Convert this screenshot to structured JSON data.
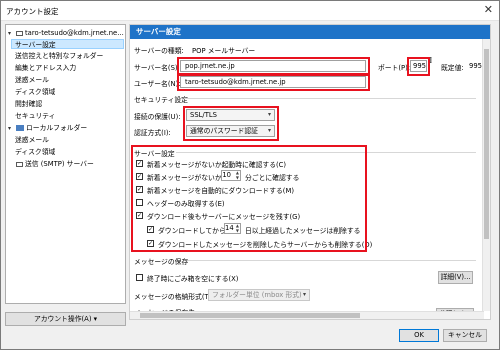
{
  "window": {
    "title": "アカウント設定",
    "close_glyph": "✕"
  },
  "tree": {
    "account": "taro-tetsudo@kdm.jrnet.ne...",
    "account_children": [
      "サーバー設定",
      "送信控えと特別なフォルダー",
      "編集とアドレス入力",
      "迷惑メール",
      "ディスク領域",
      "開封確認",
      "セキュリティ"
    ],
    "local": "ローカルフォルダー",
    "local_children": [
      "迷惑メール",
      "ディスク領域"
    ],
    "smtp": "送信 (SMTP) サーバー"
  },
  "account_actions_button": "アカウント操作(A)",
  "pane": {
    "header": "サーバー設定",
    "server_type_label": "サーバーの種類:",
    "server_type_value": "POP メールサーバー",
    "server_name_label": "サーバー名(S):",
    "server_name_value": "pop.jrnet.ne.jp",
    "port_label": "ポート(P):",
    "port_value": "995",
    "default_label": "既定値:",
    "default_value": "995",
    "username_label": "ユーザー名(N):",
    "username_value": "taro-tetsudo@kdm.jrnet.ne.jp",
    "security_title": "セキュリティ設定",
    "conn_security_label": "接続の保護(U):",
    "conn_security_value": "SSL/TLS",
    "auth_label": "認証方式(I):",
    "auth_value": "通常のパスワード認証",
    "server_settings_title": "サーバー設定",
    "check_on_startup": "新着メッセージがないか起動時に確認する(C)",
    "check_every_prefix": "新着メッセージがないか(Y)",
    "check_every_value": "10",
    "check_every_suffix": "分ごとに確認する",
    "auto_download": "新着メッセージを自動的にダウンロードする(M)",
    "headers_only": "ヘッダーのみ取得する(E)",
    "leave_on_server": "ダウンロード後もサーバーにメッセージを残す(G)",
    "delete_after_prefix": "ダウンロードしてから(O)",
    "delete_after_value": "14",
    "delete_after_suffix": "日以上経過したメッセージは削除する",
    "delete_when_deleted": "ダウンロードしたメッセージを削除したらサーバーからも削除する(D)",
    "storage_title": "メッセージの保存",
    "empty_trash": "終了時にごみ箱を空にする(X)",
    "details_button": "詳細(V)...",
    "store_type_label": "メッセージの格納形式(T):",
    "store_type_value": "フォルダー単位 (mbox 形式)",
    "store_dir_label": "メッセージの保存先:",
    "browse_button": "参照(W)..."
  },
  "footer": {
    "ok": "OK",
    "cancel": "キャンセル"
  },
  "checkboxes": {
    "check_on_startup": true,
    "check_every": true,
    "auto_download": true,
    "headers_only": false,
    "leave_on_server": true,
    "delete_after": true,
    "delete_when_deleted": true,
    "empty_trash": false
  },
  "colors": {
    "accent": "#1e73c8",
    "highlight_box": "#e8121f",
    "selection": "#cce8ff"
  }
}
